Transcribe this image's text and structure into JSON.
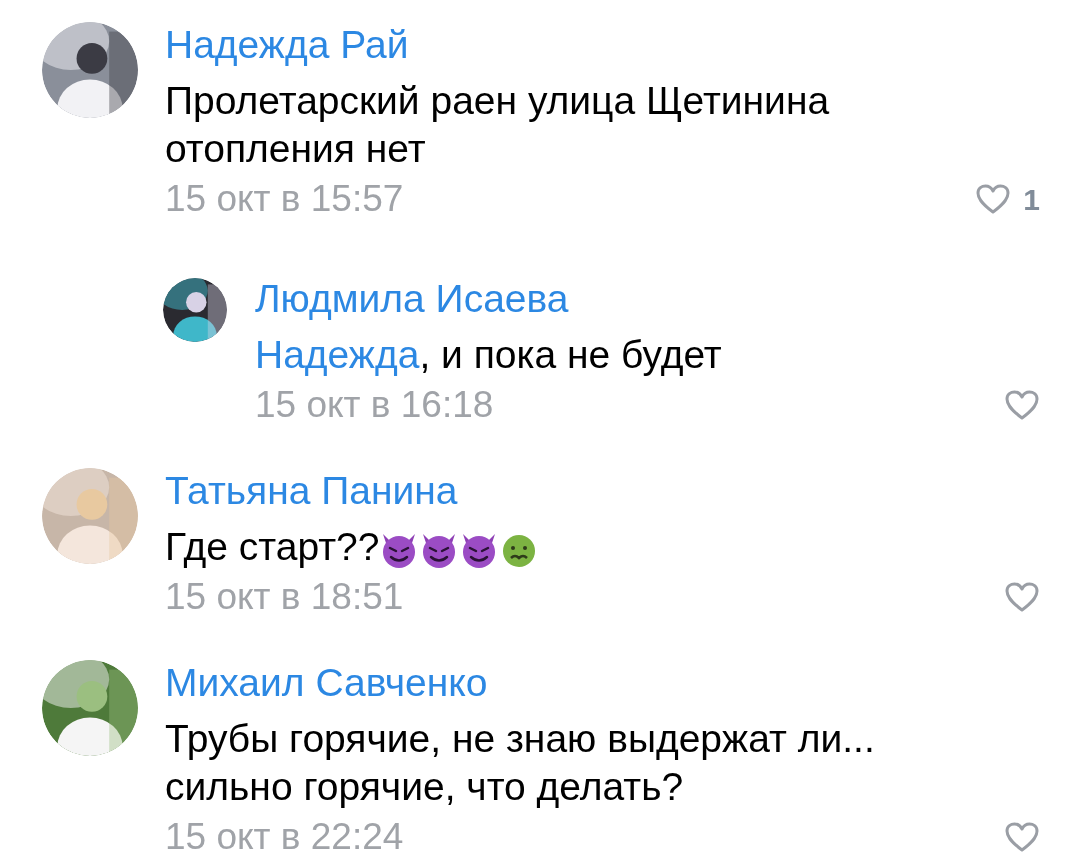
{
  "comments": [
    {
      "author": "Надежда Рай",
      "text": "Пролетарский раен улица Щетинина отопления нет",
      "time": "15 окт в 15:57",
      "likes": "1",
      "replies": [
        {
          "author": "Людмила Исаева",
          "mention": "Надежда",
          "text": ", и пока не будет",
          "time": "15 окт в 16:18"
        }
      ]
    },
    {
      "author": "Татьяна Панина",
      "text": "Где старт??",
      "emoji": [
        {
          "kind": "devil"
        },
        {
          "kind": "devil"
        },
        {
          "kind": "devil"
        },
        {
          "kind": "sick"
        }
      ],
      "time": "15 окт в 18:51"
    },
    {
      "author": "Михаил Савченко",
      "text": "Трубы горячие, не знаю выдержат ли... сильно горячие, что делать?",
      "time": "15 окт в 22:24"
    }
  ]
}
